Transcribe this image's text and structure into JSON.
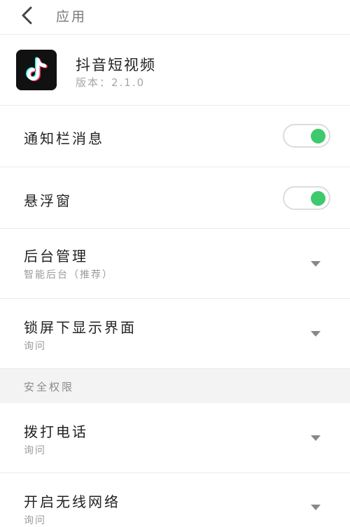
{
  "header": {
    "title": "应用",
    "back_icon": "chevron-left-icon"
  },
  "app": {
    "name": "抖音短视频",
    "version": "版本：2.1.0",
    "icon": "tiktok-logo-icon"
  },
  "settings": {
    "notification": {
      "label": "通知栏消息",
      "enabled": true
    },
    "floating_window": {
      "label": "悬浮窗",
      "enabled": true
    },
    "background": {
      "label": "后台管理",
      "value": "智能后台（推荐）"
    },
    "lockscreen": {
      "label": "锁屏下显示界面",
      "value": "询问"
    }
  },
  "security": {
    "section_title": "安全权限",
    "phone_call": {
      "label": "拨打电话",
      "value": "询问"
    },
    "wifi": {
      "label": "开启无线网络",
      "value": "询问"
    }
  },
  "colors": {
    "toggle_on": "#3ec96f",
    "logo_cyan": "#25f4ee",
    "logo_red": "#fe2c55"
  }
}
